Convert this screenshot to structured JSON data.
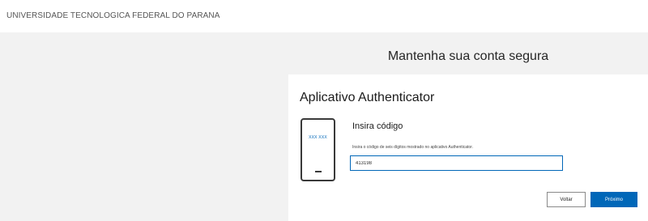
{
  "header": {
    "organization": "UNIVERSIDADE TECNOLOGICA FEDERAL DO PARANA"
  },
  "page": {
    "title": "Mantenha sua conta segura"
  },
  "card": {
    "title": "Aplicativo Authenticator",
    "phone_code": "XXX XXX",
    "code_heading": "Insira código",
    "code_description": "Insira o código de seis dígitos mostrado no aplicativo Authenticator.",
    "code_value": "413198",
    "back_label": "Voltar",
    "next_label": "Próximo"
  },
  "colors": {
    "accent": "#0067b8",
    "background": "#f2f2f2"
  },
  "icons": {
    "phone": "phone-icon"
  }
}
